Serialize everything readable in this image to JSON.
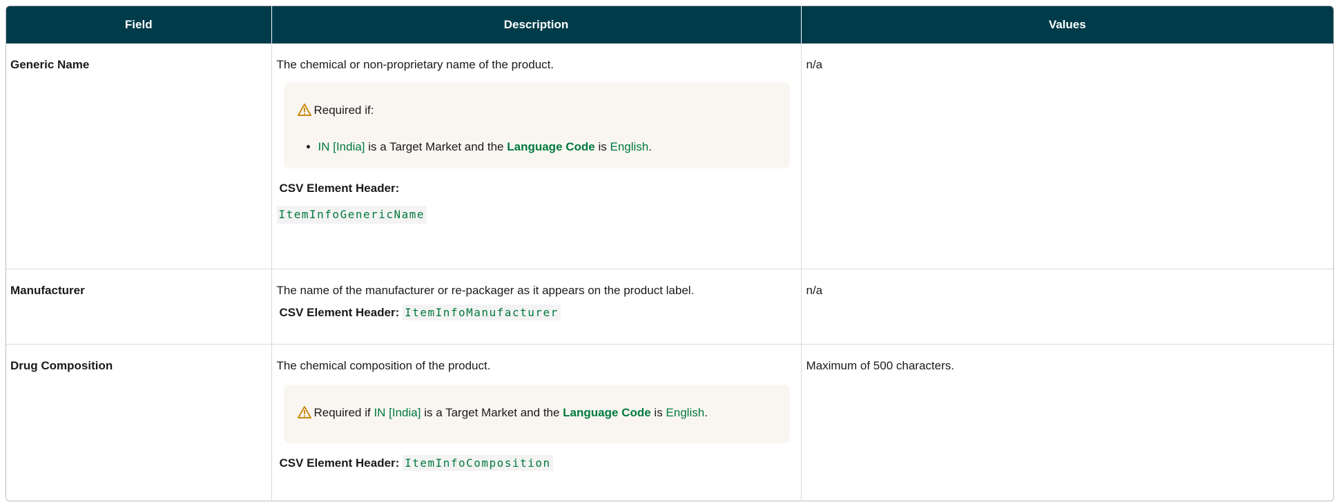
{
  "columns": {
    "field": "Field",
    "description": "Description",
    "values": "Values"
  },
  "rows": [
    {
      "field": "Generic Name",
      "description": "The chemical or non-proprietary name of the product.",
      "callout": {
        "title": "Required if:",
        "bullet": {
          "market": "IN [India]",
          "text1": " is a Target Market and the ",
          "field_ref": "Language Code",
          "text2": " is ",
          "language": "English",
          "end": "."
        }
      },
      "csv_label": "CSV Element Header:",
      "csv_value": "ItemInfoGenericName",
      "values": "n/a"
    },
    {
      "field": "Manufacturer",
      "description": "The name of the manufacturer or re-packager as it appears on the product label.",
      "csv_label": "CSV Element Header:",
      "csv_value": "ItemInfoManufacturer",
      "values": "n/a"
    },
    {
      "field": "Drug Composition",
      "description": "The chemical composition of the product.",
      "callout": {
        "prefix": "Required if ",
        "market": "IN [India]",
        "text1": " is a Target Market and the ",
        "field_ref": "Language Code",
        "text2": " is ",
        "language": "English",
        "end": "."
      },
      "csv_label": "CSV Element Header:",
      "csv_value": "ItemInfoComposition",
      "values": "Maximum of 500 characters."
    }
  ],
  "icons": {
    "warning": "warning-triangle-icon"
  },
  "colors": {
    "header_bg": "#003b4a",
    "link_green": "#00793d",
    "callout_bg": "#f9f6f1",
    "warning_icon": "#c98a10"
  }
}
